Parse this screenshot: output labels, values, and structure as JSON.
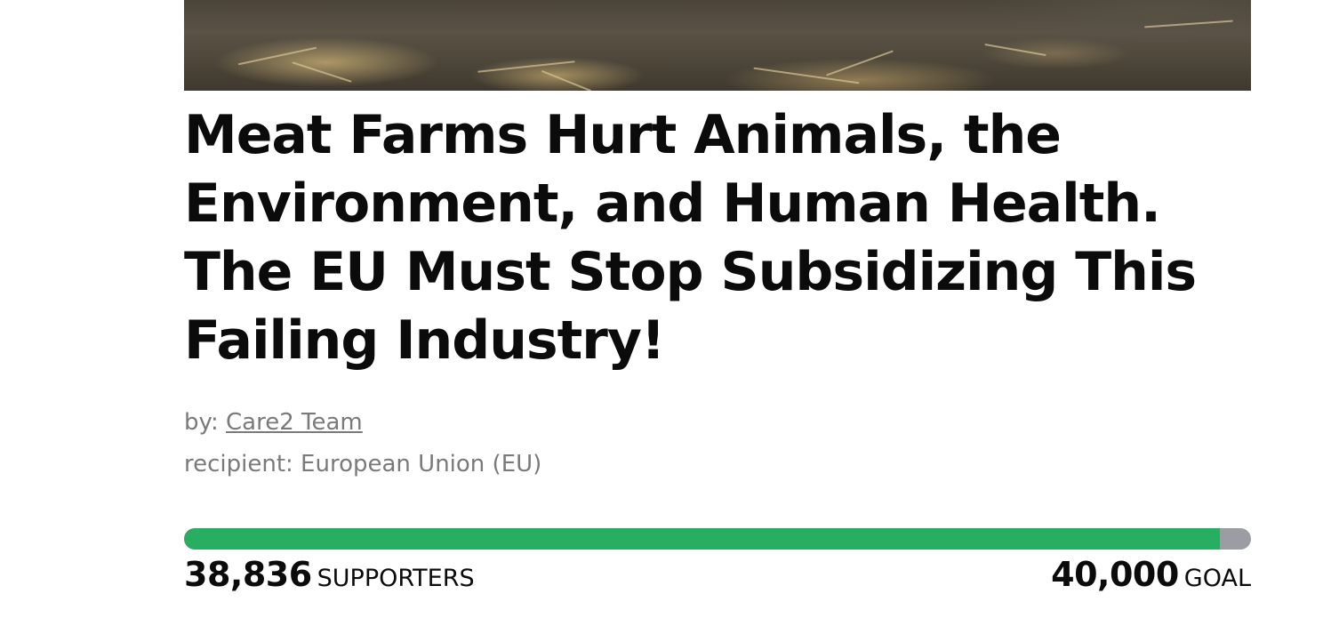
{
  "petition": {
    "title": "Meat Farms Hurt Animals, the Environment, and Human Health. The EU Must Stop Subsidizing This Failing Industry!",
    "by_prefix": "by:",
    "author": "Care2 Team",
    "recipient": "recipient: European Union (EU)"
  },
  "progress": {
    "supporters": "38,836",
    "supporters_label": "SUPPORTERS",
    "goal": "40,000",
    "goal_label": "GOAL",
    "fraction": 0.9709,
    "fill_color": "#27ae60",
    "track_color": "#9b9da2"
  }
}
